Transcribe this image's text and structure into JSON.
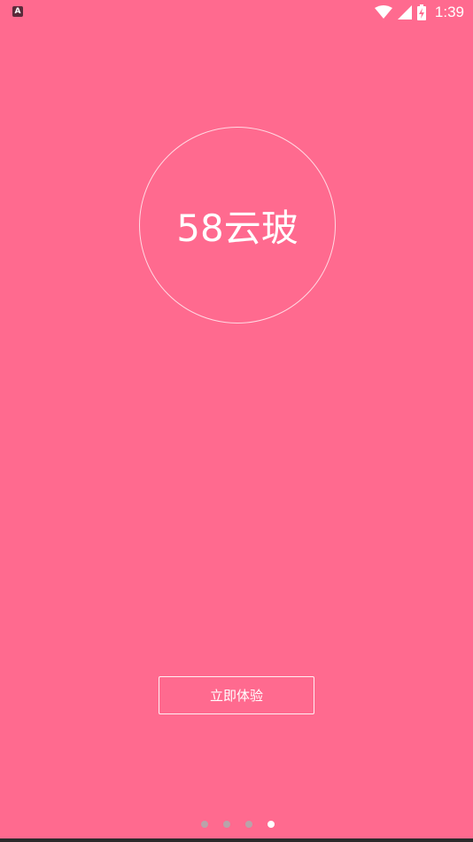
{
  "status_bar": {
    "app_icon_letter": "A",
    "time": "1:39",
    "icons": [
      "wifi-icon",
      "cell-signal-icon",
      "battery-charging-icon"
    ]
  },
  "splash": {
    "logo_text": "58云玻",
    "cta_label": "立即体验"
  },
  "pager": {
    "total_pages": 4,
    "active_index": 3
  },
  "colors": {
    "background": "#ff6a8f",
    "dot_inactive": "#b9a3aa",
    "dot_active": "#ffffff"
  }
}
